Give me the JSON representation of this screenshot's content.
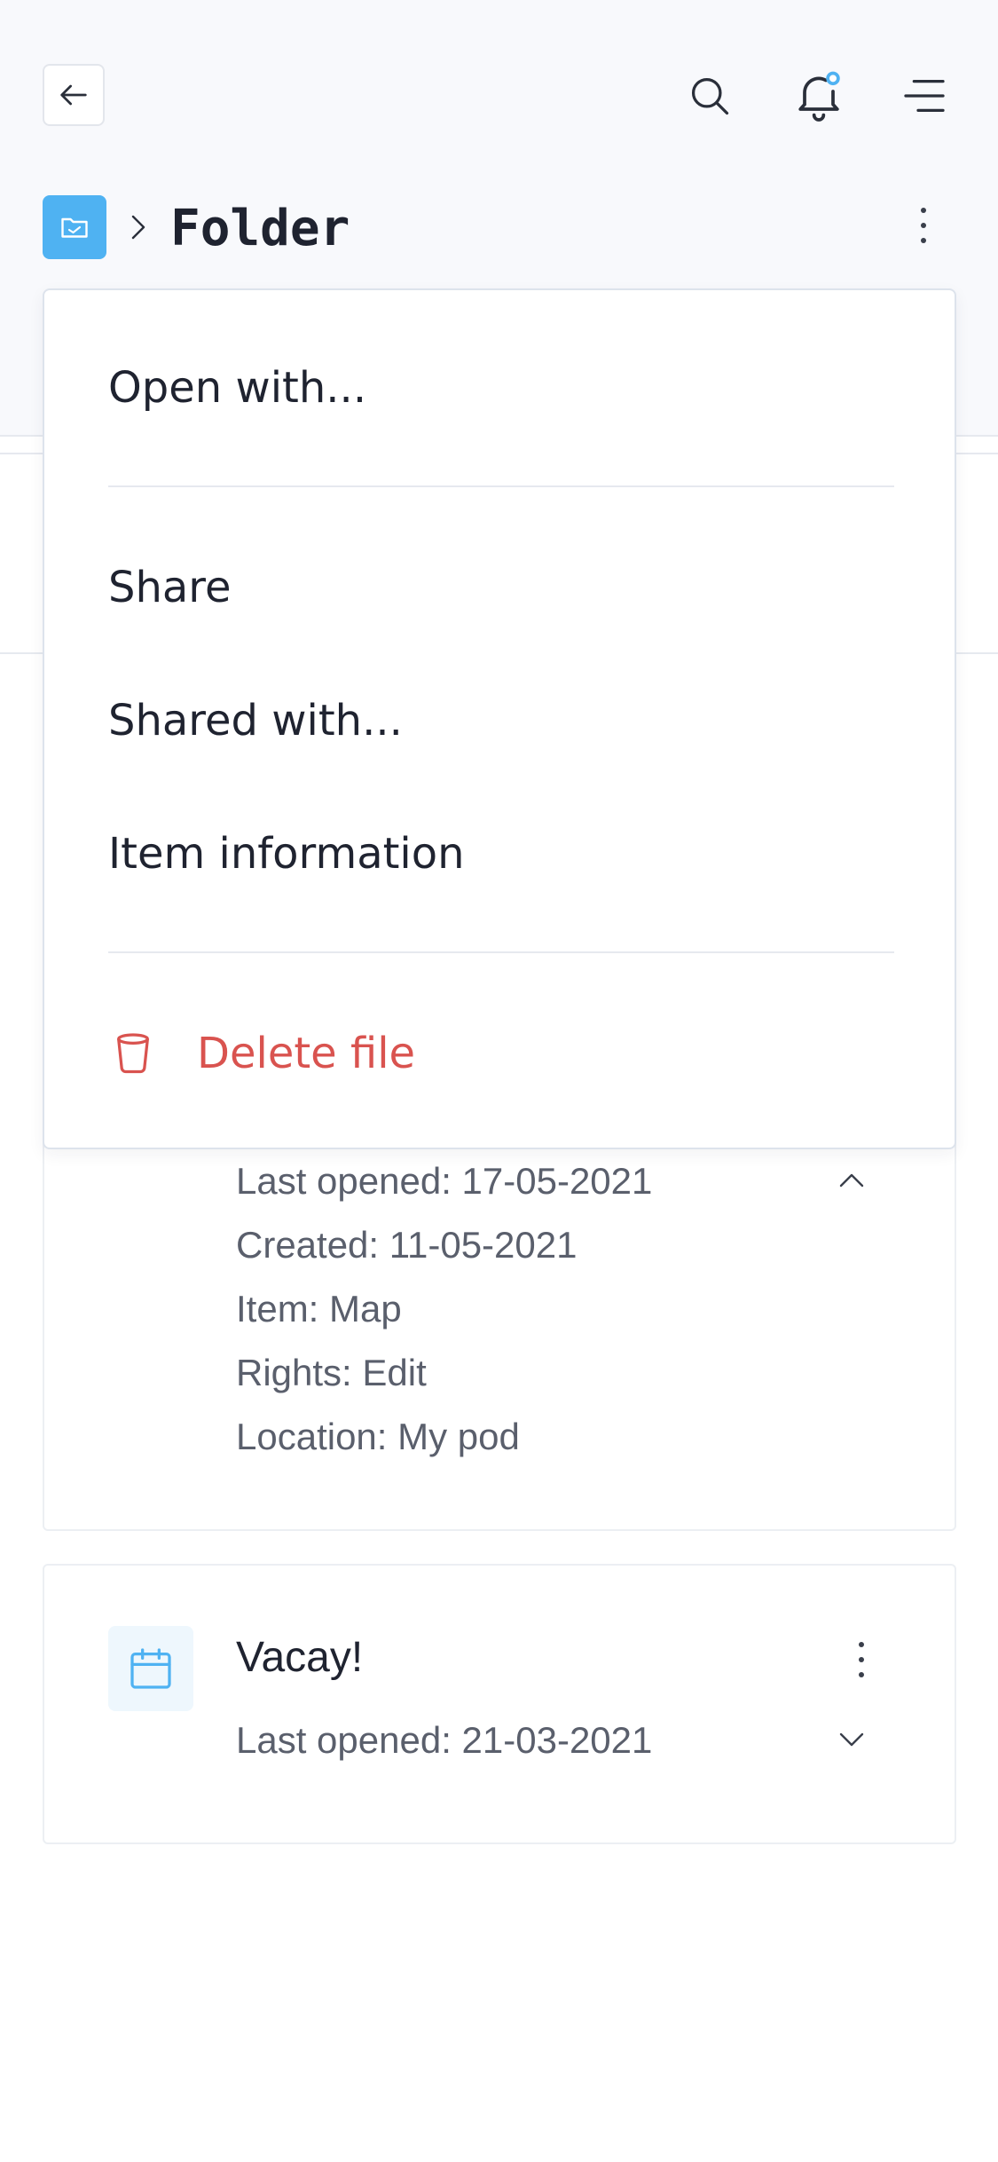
{
  "header": {
    "back_icon": "arrow-left-icon",
    "search_icon": "search-icon",
    "notification_icon": "bell-icon",
    "notification_dot_color": "#4fb2f2",
    "menu_icon": "hamburger-menu-icon"
  },
  "breadcrumb": {
    "folder_icon": "folder-icon",
    "separator_icon": "chevron-right-icon",
    "title": "Folder",
    "more_icon": "kebab-icon"
  },
  "context_menu": {
    "open_with": "Open with...",
    "share": "Share",
    "shared_with": "Shared with...",
    "item_information": "Item information",
    "delete": "Delete file",
    "delete_icon": "trash-icon",
    "delete_color": "#d9534f"
  },
  "expanded_card": {
    "last_opened": "Last opened: 17-05-2021",
    "created": "Created: 11-05-2021",
    "item": "Item: Map",
    "rights": "Rights: Edit",
    "location": "Location: My pod",
    "collapse_icon": "chevron-up-icon"
  },
  "vacay_card": {
    "icon": "calendar-icon",
    "title": "Vacay!",
    "last_opened": "Last opened: 21-03-2021",
    "more_icon": "kebab-icon",
    "expand_icon": "chevron-down-icon"
  },
  "colors": {
    "accent": "#4fb2f2",
    "danger": "#d9534f",
    "header_bg": "#f8f9fc"
  }
}
